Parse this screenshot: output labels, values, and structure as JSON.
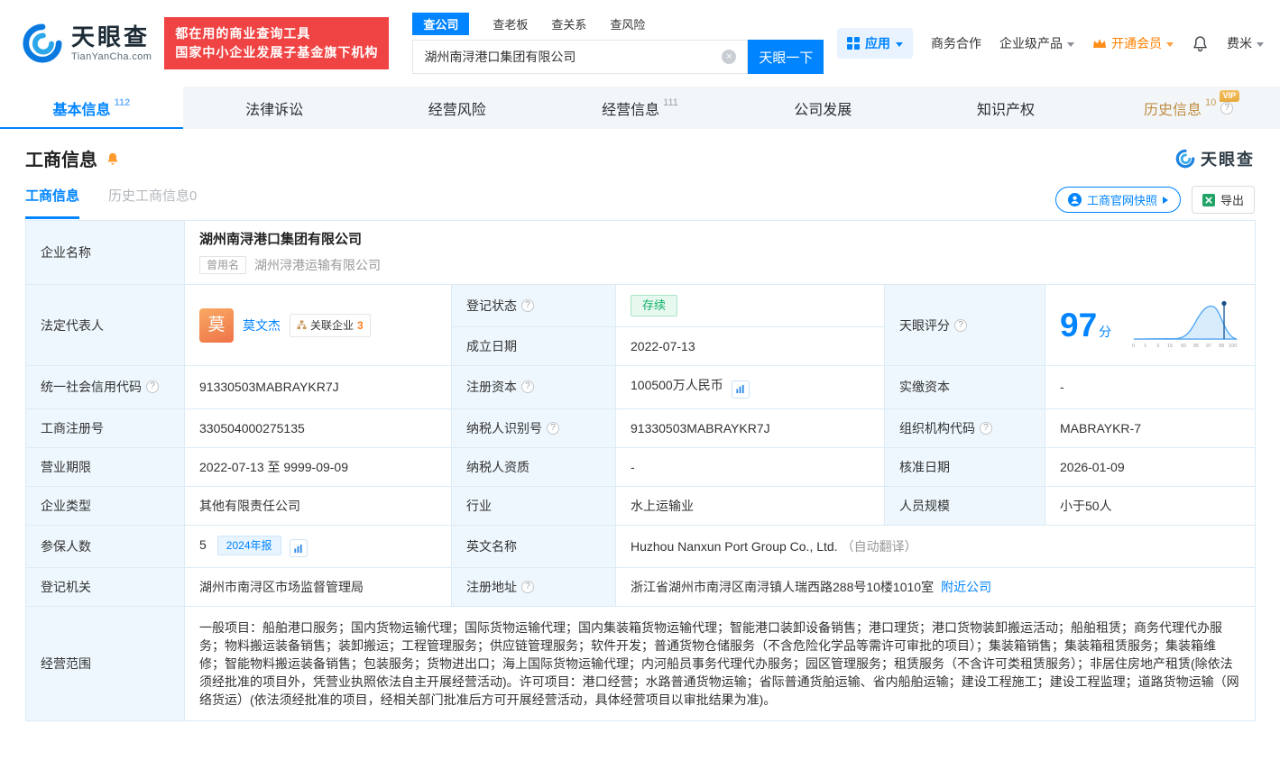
{
  "colors": {
    "accent": "#0084ff",
    "slogan_red": "#f04343",
    "vip_orange": "#ff8000",
    "status_green": "#12b269"
  },
  "icons": {
    "question_glyph": "?",
    "clear_glyph": "×",
    "vip_badge": "VIP"
  },
  "brand": {
    "logo_text": "天眼查",
    "logo_domain": "TianYanCha.com",
    "slogan_line1": "都在用的商业查询工具",
    "slogan_line2": "国家中小企业发展子基金旗下机构"
  },
  "search": {
    "tabs": [
      {
        "label": "查公司"
      },
      {
        "label": "查老板"
      },
      {
        "label": "查关系"
      },
      {
        "label": "查风险"
      }
    ],
    "value": "湖州南浔港口集团有限公司",
    "button_label": "天眼一下"
  },
  "top_menu": {
    "app_label": "应用",
    "biz_coop": "商务合作",
    "enterprise_product": "企业级产品",
    "vip_label": "开通会员",
    "username": "费米"
  },
  "nav": {
    "tabs": [
      {
        "label": "基本信息",
        "count": "112"
      },
      {
        "label": "法律诉讼",
        "count": ""
      },
      {
        "label": "经营风险",
        "count": ""
      },
      {
        "label": "经营信息",
        "count": "111"
      },
      {
        "label": "公司发展",
        "count": ""
      },
      {
        "label": "知识产权",
        "count": ""
      },
      {
        "label": "历史信息",
        "count": "10",
        "badge": "VIP"
      }
    ]
  },
  "section": {
    "title": "工商信息",
    "tab_current": "工商信息",
    "tab_history": "历史工商信息0",
    "snapshot_button": "工商官网快照",
    "export_button": "导出",
    "watermark": "天眼查"
  },
  "table": {
    "company_name": {
      "label": "企业名称",
      "value": "湖州南浔港口集团有限公司",
      "former_tag": "曾用名",
      "former_value": "湖州浔港运输有限公司"
    },
    "legal_rep": {
      "label": "法定代表人",
      "avatar_char": "莫",
      "name": "莫文杰",
      "related_label": "关联企业",
      "related_count": "3"
    },
    "reg_status": {
      "label": "登记状态",
      "value": "存续"
    },
    "establish_date": {
      "label": "成立日期",
      "value": "2022-07-13"
    },
    "score": {
      "label": "天眼评分",
      "value": "97",
      "unit": "分",
      "axis_ticks": [
        "0",
        "1",
        "3",
        "15",
        "50",
        "85",
        "97",
        "98",
        "100"
      ]
    },
    "credit_code": {
      "label": "统一社会信用代码",
      "value": "91330503MABRAYKR7J"
    },
    "reg_capital": {
      "label": "注册资本",
      "value": "100500万人民币"
    },
    "paid_capital": {
      "label": "实缴资本",
      "value": "-"
    },
    "reg_number": {
      "label": "工商注册号",
      "value": "330504000275135"
    },
    "taxpayer_id": {
      "label": "纳税人识别号",
      "value": "91330503MABRAYKR7J"
    },
    "org_code": {
      "label": "组织机构代码",
      "value": "MABRAYKR-7"
    },
    "business_term": {
      "label": "营业期限",
      "value": "2022-07-13 至 9999-09-09"
    },
    "taxpayer_quality": {
      "label": "纳税人资质",
      "value": "-"
    },
    "approval_date": {
      "label": "核准日期",
      "value": "2026-01-09"
    },
    "company_type": {
      "label": "企业类型",
      "value": "其他有限责任公司"
    },
    "industry": {
      "label": "行业",
      "value": "水上运输业"
    },
    "staff_size": {
      "label": "人员规模",
      "value": "小于50人"
    },
    "insured_count": {
      "label": "参保人数",
      "value": "5",
      "report_tag": "2024年报"
    },
    "english_name": {
      "label": "英文名称",
      "value": "Huzhou Nanxun Port Group Co., Ltd.",
      "note": "（自动翻译）"
    },
    "reg_authority": {
      "label": "登记机关",
      "value": "湖州市南浔区市场监督管理局"
    },
    "reg_address": {
      "label": "注册地址",
      "value": "浙江省湖州市南浔区南浔镇人瑞西路288号10楼1010室",
      "nearby_link": "附近公司"
    },
    "business_scope": {
      "label": "经营范围",
      "value": "一般项目：船舶港口服务；国内货物运输代理；国际货物运输代理；国内集装箱货物运输代理；智能港口装卸设备销售；港口理货；港口货物装卸搬运活动；船舶租赁；商务代理代办服务；物料搬运装备销售；装卸搬运；工程管理服务；供应链管理服务；软件开发；普通货物仓储服务（不含危险化学品等需许可审批的项目）；集装箱销售；集装箱租赁服务；集装箱维修；智能物料搬运装备销售；包装服务；货物进出口；海上国际货物运输代理；内河船员事务代理代办服务；园区管理服务；租赁服务（不含许可类租赁服务）；非居住房地产租赁(除依法须经批准的项目外，凭营业执照依法自主开展经营活动)。许可项目：港口经营；水路普通货物运输；省际普通货舶运输、省内船舶运输；建设工程施工；建设工程监理；道路货物运输（网络货运）(依法须经批准的项目，经相关部门批准后方可开展经营活动，具体经营项目以审批结果为准)。"
    }
  }
}
